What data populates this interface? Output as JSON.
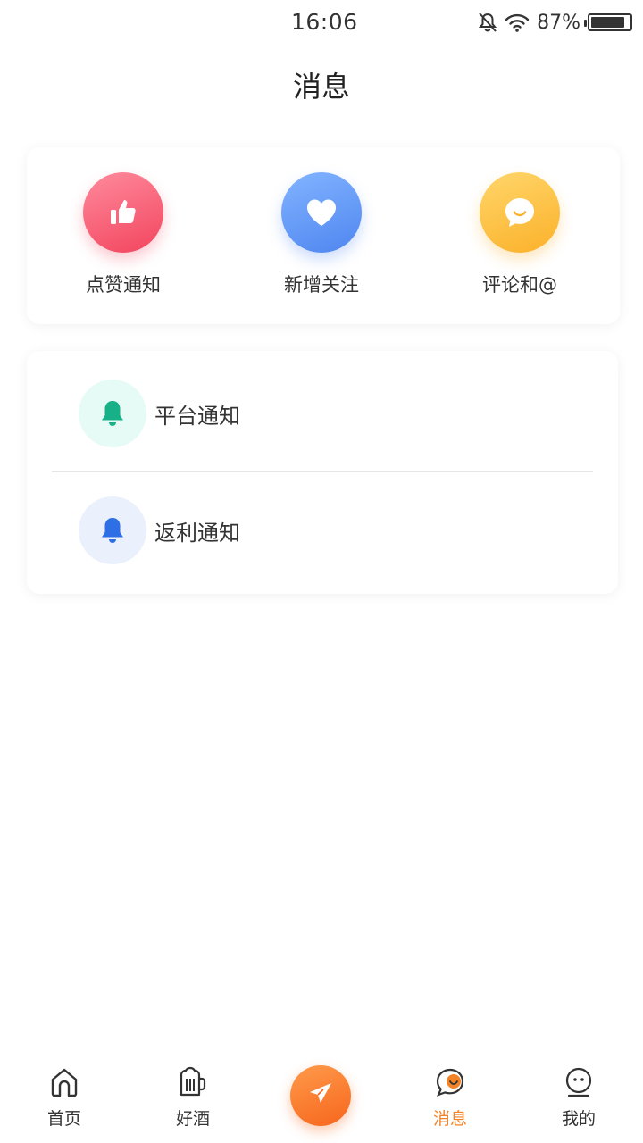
{
  "status_bar": {
    "time": "16:06",
    "battery_percent_text": "87%",
    "battery_level": 0.87,
    "icons": [
      "bell-off-icon",
      "wifi-icon",
      "battery-icon"
    ]
  },
  "header": {
    "title": "消息"
  },
  "quick_actions": [
    {
      "label": "点赞通知",
      "icon": "thumbs-up-icon",
      "color": "#f2455e"
    },
    {
      "label": "新增关注",
      "icon": "heart-icon",
      "color": "#4f86f0"
    },
    {
      "label": "评论和@",
      "icon": "chat-bubble-icon",
      "color": "#fbb12a"
    }
  ],
  "notifications": [
    {
      "label": "平台通知",
      "icon": "bell-icon",
      "color": "#17b087"
    },
    {
      "label": "返利通知",
      "icon": "bell-icon",
      "color": "#2f6fe6"
    }
  ],
  "bottom_nav": {
    "items": [
      {
        "label": "首页",
        "icon": "home-icon"
      },
      {
        "label": "好酒",
        "icon": "beer-mug-icon"
      },
      {
        "label": "",
        "icon": "paper-plane-icon"
      },
      {
        "label": "消息",
        "icon": "message-face-icon",
        "active": true
      },
      {
        "label": "我的",
        "icon": "face-icon"
      }
    ],
    "active_color": "#f38327"
  }
}
